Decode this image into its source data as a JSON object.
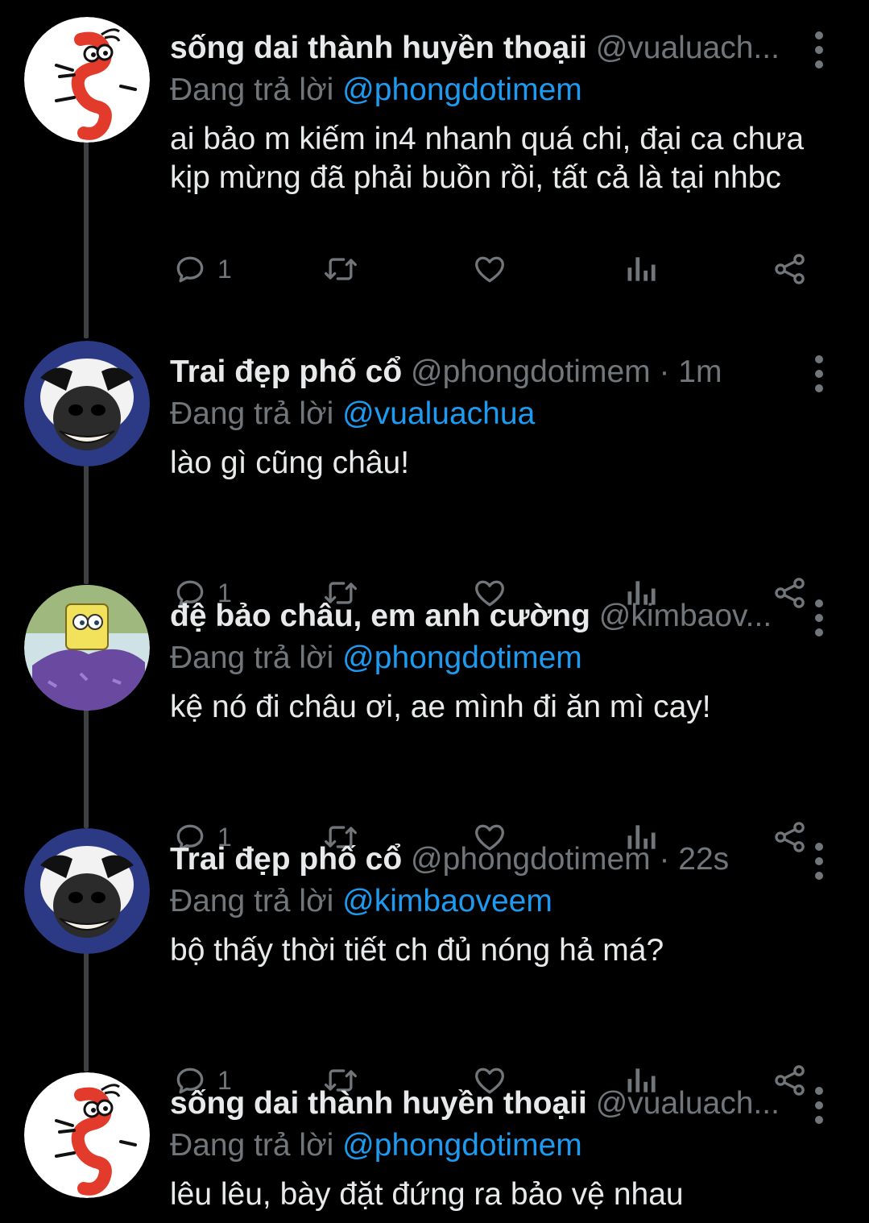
{
  "tweets": [
    {
      "name": "sống dai thành huyền thoạii",
      "handle": "@vualuach...",
      "replying_prefix": "Đang trả lời",
      "replying_to": "@phongdotimem",
      "text": "ai bảo m kiếm in4 nhanh quá chi, đại ca chưa kịp mừng đã phải buồn rồi, tất cả là tại nhbc",
      "reply_count": "1",
      "avatar": "dragon-avatar"
    },
    {
      "name": "Trai đẹp phố cổ",
      "handle": "@phongdotimem · 1m",
      "replying_prefix": "Đang trả lời",
      "replying_to": "@vualuachua",
      "text": "lào gì cũng châu!",
      "reply_count": "1",
      "avatar": "cow-avatar"
    },
    {
      "name": "đệ bảo châu, em anh cường",
      "handle": "@kimbaov...",
      "replying_prefix": "Đang trả lời",
      "replying_to": "@phongdotimem",
      "text": "kệ nó đi châu ơi, ae mình đi ăn mì cay!",
      "reply_count": "1",
      "avatar": "spongebob-avatar"
    },
    {
      "name": "Trai đẹp phố cổ",
      "handle": "@phongdotimem · 22s",
      "replying_prefix": "Đang trả lời",
      "replying_to": "@kimbaoveem",
      "text": "bộ thấy thời tiết ch đủ nóng hả má?",
      "reply_count": "1",
      "avatar": "cow-avatar"
    },
    {
      "name": "sống dai thành huyền thoạii",
      "handle": "@vualuach...",
      "replying_prefix": "Đang trả lời",
      "replying_to": "@phongdotimem",
      "text": "lêu lêu, bày đặt đứng ra bảo vệ nhau",
      "reply_count": "",
      "avatar": "dragon-avatar"
    }
  ],
  "icons": {
    "reply": "reply-icon",
    "retweet": "retweet-icon",
    "like": "heart-icon",
    "views": "views-icon",
    "share": "share-icon",
    "more": "more-vertical-icon"
  },
  "colors": {
    "background": "#000000",
    "text": "#e7e9ea",
    "secondary": "#71767b",
    "accent": "#1d9bf0",
    "thread_line": "#3e4144"
  }
}
